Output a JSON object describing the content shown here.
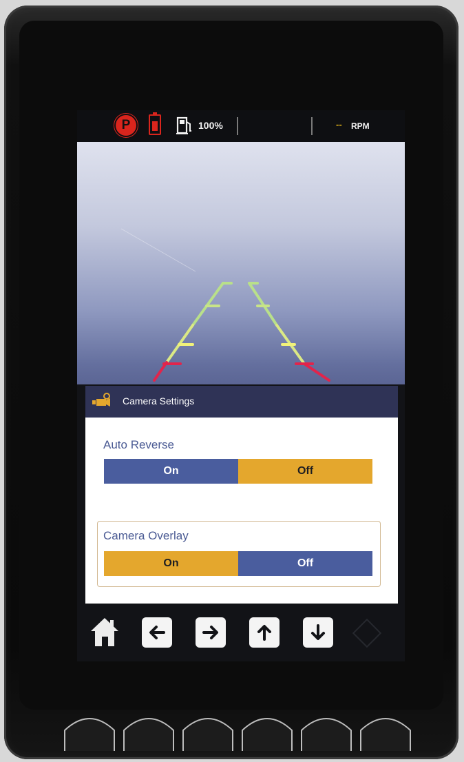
{
  "status_bar": {
    "fuel_level": "100%",
    "rpm_value": "--",
    "rpm_label": "RPM",
    "icons": [
      "parking-brake-icon",
      "battery-icon",
      "fuel-pump-icon"
    ],
    "alert_color": "#d9251d"
  },
  "camera_view": {
    "guideline_colors": {
      "far": "#b9e08a",
      "mid": "#f1f27a",
      "near": "#e2244b"
    }
  },
  "camera_settings": {
    "header_icon": "camera-settings-icon",
    "title": "Camera Settings",
    "auto_reverse": {
      "label": "Auto Reverse",
      "options": [
        "On",
        "Off"
      ],
      "selected": "Off"
    },
    "camera_overlay": {
      "label": "Camera Overlay",
      "options": [
        "On",
        "Off"
      ],
      "selected": "On"
    }
  },
  "nav_bar": {
    "buttons": [
      "home-icon",
      "arrow-left-icon",
      "arrow-right-icon",
      "arrow-up-icon",
      "arrow-down-icon",
      "enter-icon"
    ]
  },
  "hardware_keys": {
    "count": 6
  },
  "colors": {
    "panel_header": "#2f3356",
    "segment_blue": "#4a5d9e",
    "segment_orange": "#e4a72d",
    "label_blue": "#4a5a93",
    "rpm_accent": "#e3b418"
  }
}
